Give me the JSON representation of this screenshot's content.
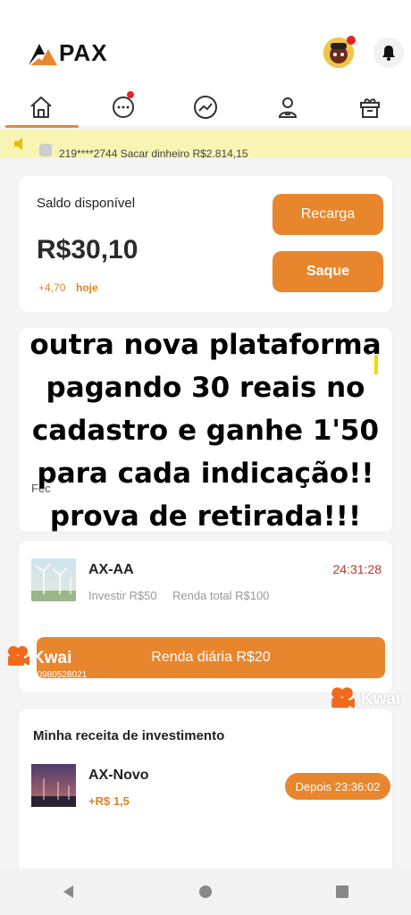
{
  "app": {
    "brand": "PAX"
  },
  "nav": {
    "items": [
      {
        "name": "home",
        "active": true
      },
      {
        "name": "messages",
        "badge": true
      },
      {
        "name": "market"
      },
      {
        "name": "profile"
      },
      {
        "name": "gift"
      }
    ]
  },
  "marquee": {
    "text": "219****2744 Sacar dinheiro R$2.814,15"
  },
  "balance": {
    "label": "Saldo disponível",
    "value": "R$30,10",
    "delta": "+4,70",
    "delta_suffix": "hoje",
    "recharge_label": "Recarga",
    "withdraw_label": "Saque"
  },
  "overlay": {
    "lines": [
      "outra nova plataforma",
      "pagando 30 reais no",
      "cadastro e ganhe 1'50",
      "para cada indicação!!",
      "prova de retirada!!!"
    ],
    "partial_text": "Fec"
  },
  "product": {
    "name": "AX-AA",
    "timer": "24:31:28",
    "invest": "Investir R$50",
    "total": "Renda total R$100",
    "daily_button": "Renda diária R$20"
  },
  "watermark": {
    "brand": "Kwai",
    "id": "00980528021"
  },
  "income": {
    "title": "Minha receita de investimento",
    "item_name": "AX-Novo",
    "item_gain": "+R$ 1,5",
    "countdown": "Depois 23:36:02"
  },
  "colors": {
    "accent": "#e8862e",
    "marquee_bg": "#f8f4b4",
    "timer": "#b53a2a"
  }
}
